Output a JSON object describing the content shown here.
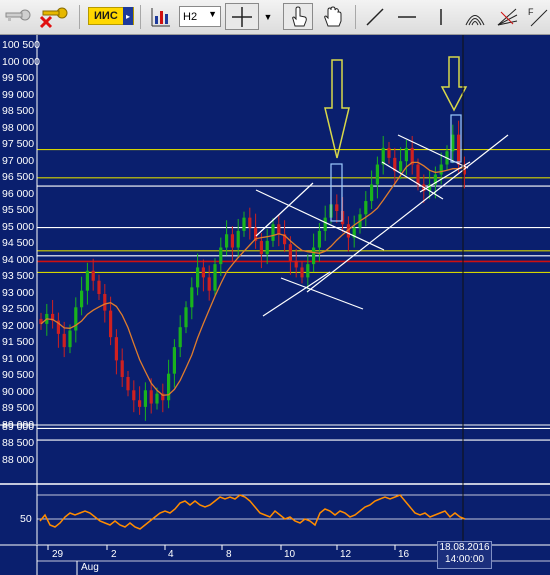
{
  "toolbar": {
    "account_label": "ИИС",
    "timeframe": "H2",
    "icons": [
      "key-icon",
      "delete-key-icon",
      "account-dropdown",
      "indicators-icon",
      "timeframe-dropdown",
      "crosshair-icon",
      "crosshair-dropdown-arrow",
      "hand-pointer-icon",
      "hand-pan-icon",
      "trend-line-icon",
      "horizontal-line-icon",
      "vertical-line-icon",
      "arc-icon",
      "fan-icon",
      "fibonacci-icon"
    ]
  },
  "price_axis": {
    "labels": [
      "100 500",
      "100 000",
      "99 500",
      "99 000",
      "98 500",
      "98 000",
      "97 500",
      "97 000",
      "96 500",
      "96 000",
      "95 500",
      "95 000",
      "94 500",
      "94 000",
      "93 500",
      "93 000",
      "92 500",
      "92 000",
      "91 500",
      "91 000",
      "90 500",
      "90 000",
      "89 500",
      "89 000",
      "89 000",
      "88 500",
      "88 000"
    ]
  },
  "time_axis": {
    "day_labels": [
      "29",
      "2",
      "4",
      "8",
      "10",
      "12",
      "16"
    ],
    "month_label": "Aug",
    "cursor_date": "18.08.2016",
    "cursor_time": "14:00:00"
  },
  "oscillator": {
    "level_label": "50"
  },
  "colors": {
    "background": "#0a1f6e",
    "bull": "#19b31d",
    "bear": "#cf2020",
    "ma": "#e07c2c",
    "yellow_level": "#d4d400",
    "red_level": "#d01010",
    "white_level": "#ffffff",
    "oscillator": "#ff8c00"
  },
  "chart_data": {
    "type": "candlestick",
    "y_axis": {
      "min": 87500,
      "max": 100600
    },
    "x_axis_days": [
      "29",
      "2",
      "4",
      "8",
      "10",
      "12",
      "16"
    ],
    "horizontal_levels": [
      {
        "price": 97350,
        "color": "yellow"
      },
      {
        "price": 96500,
        "color": "yellow"
      },
      {
        "price": 96250,
        "color": "white"
      },
      {
        "price": 95000,
        "color": "white"
      },
      {
        "price": 94300,
        "color": "yellow"
      },
      {
        "price": 94150,
        "color": "white"
      },
      {
        "price": 93980,
        "color": "red"
      },
      {
        "price": 93650,
        "color": "yellow"
      },
      {
        "price": 88950,
        "color": "white"
      },
      {
        "price": 88600,
        "color": "white"
      }
    ],
    "close_series": [
      92100,
      92400,
      92200,
      91800,
      91400,
      91900,
      92600,
      93100,
      93700,
      93400,
      93000,
      92500,
      91700,
      91000,
      90500,
      90100,
      89800,
      89600,
      90100,
      89700,
      90000,
      89800,
      90600,
      91400,
      92000,
      92600,
      93200,
      93800,
      93500,
      93100,
      93900,
      94400,
      94800,
      94400,
      94900,
      95300,
      95000,
      94600,
      94200,
      94600,
      95100,
      94800,
      94500,
      94000,
      93800,
      93500,
      93900,
      94400,
      94900,
      95300,
      95700,
      95500,
      95100,
      94700,
      95000,
      95400,
      95800,
      96300,
      96900,
      97400,
      97100,
      96700,
      97000,
      97400,
      96900,
      96300,
      96100,
      96300,
      96600,
      96900,
      97300,
      97800,
      96900,
      96600
    ]
  }
}
